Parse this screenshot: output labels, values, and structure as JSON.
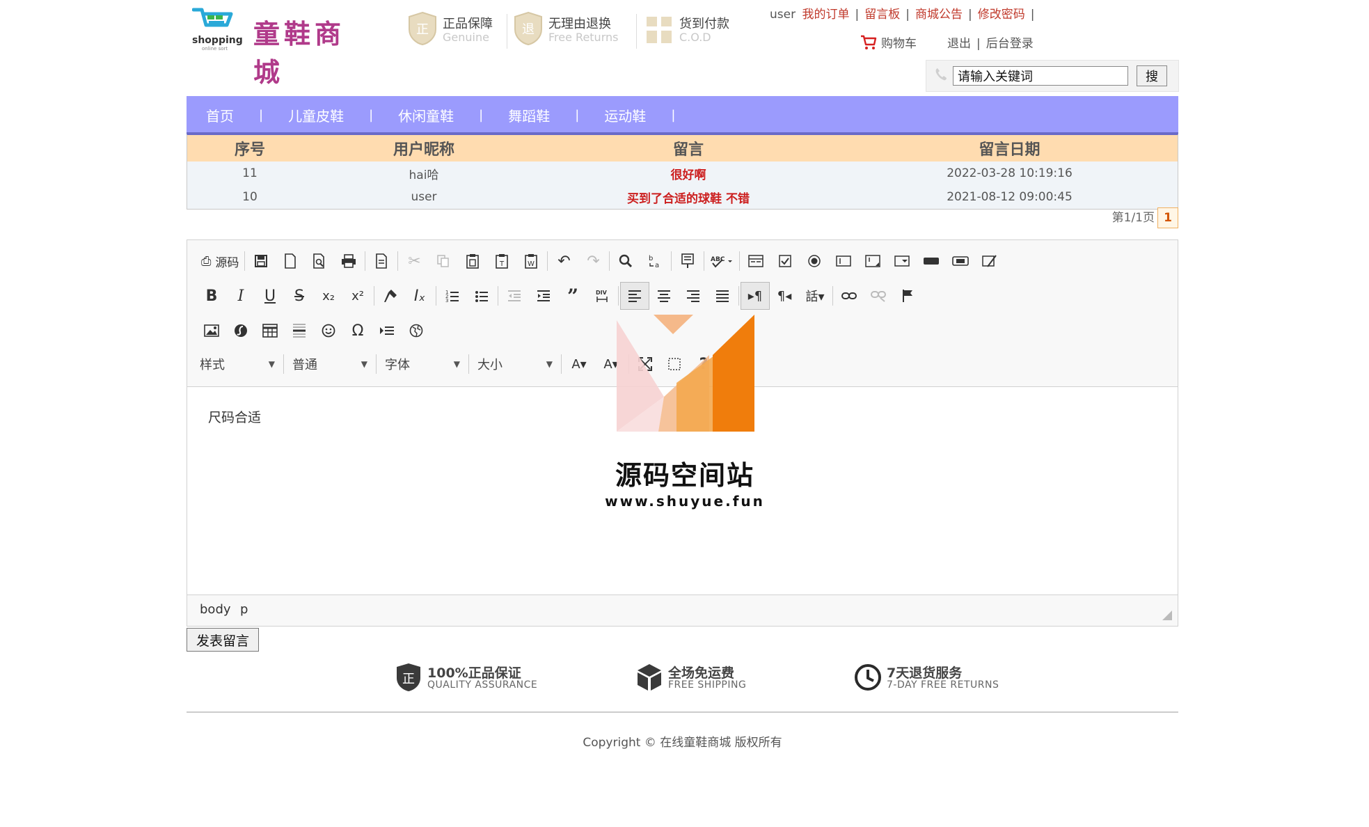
{
  "header": {
    "logo_word": "shopping",
    "logo_sub": "online sort",
    "site_title": "童鞋商城",
    "badges": [
      {
        "title": "正品保障",
        "sub": "Genuine"
      },
      {
        "title": "无理由退换",
        "sub": "Free Returns"
      },
      {
        "title": "货到付款",
        "sub": "C.O.D"
      }
    ],
    "user": "user",
    "links": [
      "我的订单",
      "留言板",
      "商城公告",
      "修改密码"
    ],
    "cart": "购物车",
    "logout": "退出",
    "admin_login": "后台登录",
    "search_value": "请输入关键词",
    "search_btn": "搜"
  },
  "nav": [
    "首页",
    "儿童皮鞋",
    "休闲童鞋",
    "舞蹈鞋",
    "运动鞋"
  ],
  "table": {
    "headers": [
      "序号",
      "用户昵称",
      "留言",
      "留言日期"
    ],
    "rows": [
      {
        "id": "11",
        "nick": "hai哈",
        "msg": "很好啊",
        "date": "2022-03-28 10:19:16"
      },
      {
        "id": "10",
        "nick": "user",
        "msg": "买到了合适的球鞋 不错",
        "date": "2021-08-12 09:00:45"
      }
    ]
  },
  "pager": {
    "label": "第1/1页",
    "current": "1"
  },
  "editor": {
    "source_label": "源码",
    "combos": [
      "样式",
      "普通",
      "字体",
      "大小"
    ],
    "content": "尺码合适",
    "path": [
      "body",
      "p"
    ]
  },
  "post_btn": "发表留言",
  "footer": {
    "services": [
      {
        "title": "100%正品保证",
        "sub": "QUALITY ASSURANCE"
      },
      {
        "title": "全场免运费",
        "sub": "FREE SHIPPING"
      },
      {
        "title": "7天退货服务",
        "sub": "7-DAY FREE RETURNS"
      }
    ],
    "copyright": "Copyright © 在线童鞋商城 版权所有"
  },
  "watermark": {
    "title": "源码空间站",
    "url": "www.shuyue.fun"
  },
  "colors": {
    "nav_bg": "#9b9bfd",
    "table_header": "#ffdcb0",
    "link_red": "#c0392b",
    "msg_red": "#cc1f1f",
    "brand_purple": "#b03a8a",
    "watermark_orange": "#f39a2b"
  }
}
